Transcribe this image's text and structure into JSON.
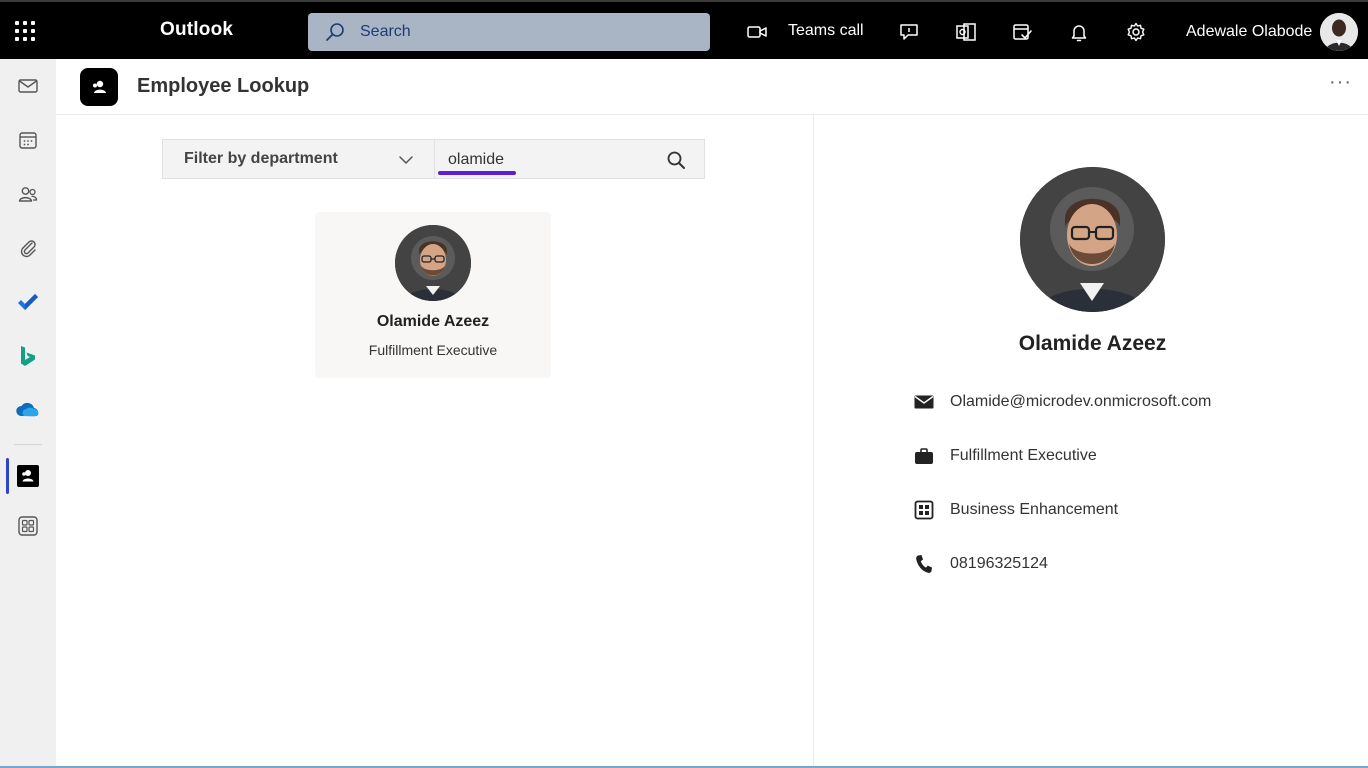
{
  "topbar": {
    "brand": "Outlook",
    "search_placeholder": "Search",
    "teams_call_label": "Teams call",
    "user_name": "Adewale Olabode"
  },
  "app": {
    "title": "Employee Lookup"
  },
  "filters": {
    "department_label": "Filter by department",
    "search_value": "olamide"
  },
  "results": [
    {
      "name": "Olamide Azeez",
      "role": "Fulfillment Executive"
    }
  ],
  "detail": {
    "name": "Olamide Azeez",
    "email": "Olamide@microdev.onmicrosoft.com",
    "job_title": "Fulfillment Executive",
    "department": "Business Enhancement",
    "phone": "08196325124"
  },
  "colors": {
    "topbar_bg": "#000000",
    "search_bg": "#a9b4c4",
    "active_indicator": "#2f45c8",
    "search_underline": "#5b1fd6",
    "todo_blue": "#1a73e8",
    "bing_teal": "#14a085",
    "onedrive_blue": "#0f6cbd"
  }
}
